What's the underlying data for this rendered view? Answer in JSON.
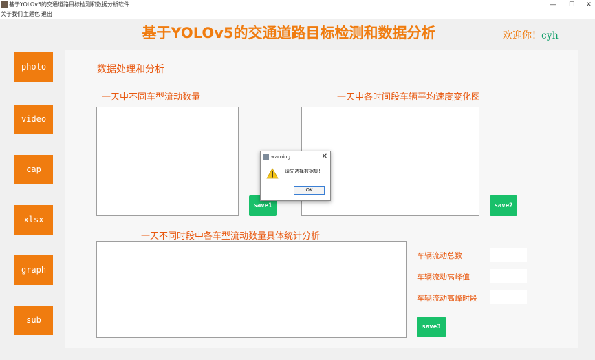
{
  "window": {
    "title": "基于YOLOv5的交通道路目标检测和数据分析软件",
    "controls": {
      "minimize": "—",
      "maximize": "☐",
      "close": "✕"
    }
  },
  "menu": [
    "关于我们",
    "主题色",
    "退出"
  ],
  "header": {
    "title": "基于YOLOv5的交通道路目标检测和数据分析",
    "welcome_prefix": "欢迎你！",
    "username": "cyh"
  },
  "sidebar": {
    "buttons": [
      {
        "label": "photo"
      },
      {
        "label": "video"
      },
      {
        "label": "cap"
      },
      {
        "label": "xlsx"
      },
      {
        "label": "graph"
      },
      {
        "label": "sub"
      }
    ]
  },
  "main": {
    "section_title": "数据处理和分析",
    "chart1_label": "一天中不同车型流动数量",
    "chart2_label": "一天中各时间段车辆平均速度变化图",
    "table_label": "一天不同时段中各车型流动数量具体统计分析",
    "save1": "save1",
    "save2": "save2",
    "save3": "save3",
    "stats": [
      {
        "label": "车辆流动总数",
        "value": ""
      },
      {
        "label": "车辆流动高峰值",
        "value": ""
      },
      {
        "label": "车辆流动高峰时段",
        "value": ""
      }
    ]
  },
  "dialog": {
    "title": "warning",
    "message": "请先选择数据集!",
    "ok_label": "OK",
    "icon": "warning-icon"
  },
  "colors": {
    "accent_orange": "#f07c0f",
    "label_red_orange": "#e8580f",
    "save_green": "#19c06a",
    "username_green": "#14a06c"
  }
}
